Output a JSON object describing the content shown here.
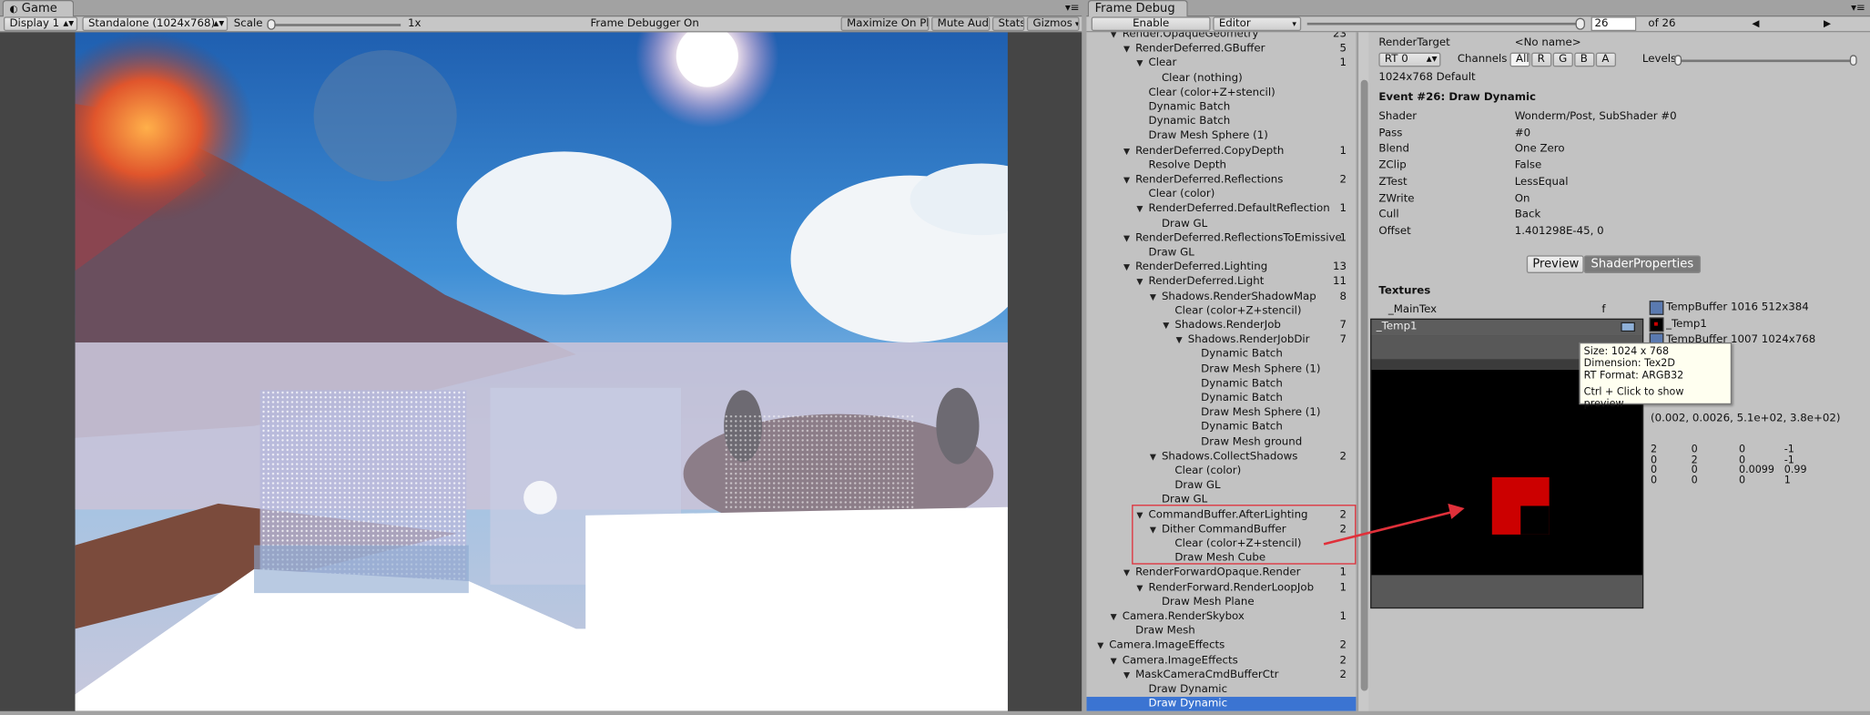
{
  "game": {
    "tab": "Game",
    "display": "Display 1",
    "resolution": "Standalone (1024x768)",
    "scale_label": "Scale",
    "scale_value": "1x",
    "status": "Frame Debugger On",
    "maximize": "Maximize On Play",
    "mute": "Mute Audio",
    "stats": "Stats",
    "gizmos": "Gizmos"
  },
  "fd": {
    "tab": "Frame Debug",
    "enable": "Enable",
    "target": "Editor",
    "event_index": "26",
    "event_total": "of 26",
    "slider_position_fraction": 1.0
  },
  "tree": [
    {
      "label": "Render.OpaqueGeometry",
      "count": "23",
      "indent": 2,
      "open": true
    },
    {
      "label": "RenderDeferred.GBuffer",
      "count": "5",
      "indent": 3,
      "open": true
    },
    {
      "label": "Clear",
      "count": "1",
      "indent": 4,
      "open": true
    },
    {
      "label": "Clear (nothing)",
      "count": "",
      "indent": 5
    },
    {
      "label": "Clear (color+Z+stencil)",
      "count": "",
      "indent": 4
    },
    {
      "label": "Dynamic Batch",
      "count": "",
      "indent": 4
    },
    {
      "label": "Dynamic Batch",
      "count": "",
      "indent": 4
    },
    {
      "label": "Draw Mesh Sphere (1)",
      "count": "",
      "indent": 4
    },
    {
      "label": "RenderDeferred.CopyDepth",
      "count": "1",
      "indent": 3,
      "open": true
    },
    {
      "label": "Resolve Depth",
      "count": "",
      "indent": 4
    },
    {
      "label": "RenderDeferred.Reflections",
      "count": "2",
      "indent": 3,
      "open": true
    },
    {
      "label": "Clear (color)",
      "count": "",
      "indent": 4
    },
    {
      "label": "RenderDeferred.DefaultReflection",
      "count": "1",
      "indent": 4,
      "open": true
    },
    {
      "label": "Draw GL",
      "count": "",
      "indent": 5
    },
    {
      "label": "RenderDeferred.ReflectionsToEmissive",
      "count": "1",
      "indent": 3,
      "open": true
    },
    {
      "label": "Draw GL",
      "count": "",
      "indent": 4
    },
    {
      "label": "RenderDeferred.Lighting",
      "count": "13",
      "indent": 3,
      "open": true
    },
    {
      "label": "RenderDeferred.Light",
      "count": "11",
      "indent": 4,
      "open": true
    },
    {
      "label": "Shadows.RenderShadowMap",
      "count": "8",
      "indent": 5,
      "open": true
    },
    {
      "label": "Clear (color+Z+stencil)",
      "count": "",
      "indent": 6
    },
    {
      "label": "Shadows.RenderJob",
      "count": "7",
      "indent": 6,
      "open": true
    },
    {
      "label": "Shadows.RenderJobDir",
      "count": "7",
      "indent": 7,
      "open": true
    },
    {
      "label": "Dynamic Batch",
      "count": "",
      "indent": 8
    },
    {
      "label": "Draw Mesh Sphere (1)",
      "count": "",
      "indent": 8
    },
    {
      "label": "Dynamic Batch",
      "count": "",
      "indent": 8
    },
    {
      "label": "Dynamic Batch",
      "count": "",
      "indent": 8
    },
    {
      "label": "Draw Mesh Sphere (1)",
      "count": "",
      "indent": 8
    },
    {
      "label": "Dynamic Batch",
      "count": "",
      "indent": 8
    },
    {
      "label": "Draw Mesh ground",
      "count": "",
      "indent": 8
    },
    {
      "label": "Shadows.CollectShadows",
      "count": "2",
      "indent": 5,
      "open": true
    },
    {
      "label": "Clear (color)",
      "count": "",
      "indent": 6
    },
    {
      "label": "Draw GL",
      "count": "",
      "indent": 6
    },
    {
      "label": "Draw GL",
      "count": "",
      "indent": 5
    },
    {
      "label": "CommandBuffer.AfterLighting",
      "count": "2",
      "indent": 4,
      "open": true
    },
    {
      "label": "Dither CommandBuffer",
      "count": "2",
      "indent": 5,
      "open": true
    },
    {
      "label": "Clear (color+Z+stencil)",
      "count": "",
      "indent": 6
    },
    {
      "label": "Draw Mesh Cube",
      "count": "",
      "indent": 6
    },
    {
      "label": "RenderForwardOpaque.Render",
      "count": "1",
      "indent": 3,
      "open": true
    },
    {
      "label": "RenderForward.RenderLoopJob",
      "count": "1",
      "indent": 4,
      "open": true
    },
    {
      "label": "Draw Mesh Plane",
      "count": "",
      "indent": 5
    },
    {
      "label": "Camera.RenderSkybox",
      "count": "1",
      "indent": 2,
      "open": true
    },
    {
      "label": "Draw Mesh",
      "count": "",
      "indent": 3
    },
    {
      "label": "Camera.ImageEffects",
      "count": "2",
      "indent": 1,
      "open": true
    },
    {
      "label": "Camera.ImageEffects",
      "count": "2",
      "indent": 2,
      "open": true
    },
    {
      "label": "MaskCameraCmdBufferCtr",
      "count": "2",
      "indent": 3,
      "open": true
    },
    {
      "label": "Draw Dynamic",
      "count": "",
      "indent": 4
    },
    {
      "label": "Draw Dynamic",
      "count": "",
      "indent": 4,
      "selected": true
    }
  ],
  "detail": {
    "render_target_label": "RenderTarget",
    "render_target_value": "<No name>",
    "rt": "RT 0",
    "channels": "Channels",
    "ch_all": "All",
    "ch_r": "R",
    "ch_g": "G",
    "ch_b": "B",
    "ch_a": "A",
    "levels": "Levels",
    "size_default": "1024x768 Default",
    "event_title": "Event #26: Draw Dynamic",
    "props": [
      {
        "k": "Shader",
        "v": "Wonderm/Post, SubShader #0"
      },
      {
        "k": "Pass",
        "v": "#0"
      },
      {
        "k": "Blend",
        "v": "One Zero"
      },
      {
        "k": "ZClip",
        "v": "False"
      },
      {
        "k": "ZTest",
        "v": "LessEqual"
      },
      {
        "k": "ZWrite",
        "v": "On"
      },
      {
        "k": "Cull",
        "v": "Back"
      },
      {
        "k": "Offset",
        "v": "1.401298E-45, 0"
      }
    ],
    "btn_preview": "Preview",
    "btn_shaderprops": "ShaderProperties",
    "textures": "Textures",
    "maintex": "_MainTex",
    "maintex_flag": "f",
    "tex1": "TempBuffer 1016 512x384",
    "tex2": "_Temp1",
    "tex3": "TempBuffer 1007 1024x768",
    "popup_title": "_Temp1",
    "tooltip_size": "Size: 1024 x 768",
    "tooltip_dim": "Dimension: Tex2D",
    "tooltip_fmt": "RT Format: ARGB32",
    "tooltip_hint": "Ctrl + Click to show preview",
    "vector": "(0.002, 0.0026, 5.1e+02, 3.8e+02)",
    "matrix": [
      [
        "2",
        "0",
        "0",
        "-1"
      ],
      [
        "0",
        "2",
        "0",
        "-1"
      ],
      [
        "0",
        "0",
        "0.0099",
        "0.99"
      ],
      [
        "0",
        "0",
        "0",
        "1"
      ]
    ]
  },
  "colors": {
    "highlight": "#3b74d2",
    "annotation": "#e0303a",
    "preview_red": "#cc0000"
  }
}
